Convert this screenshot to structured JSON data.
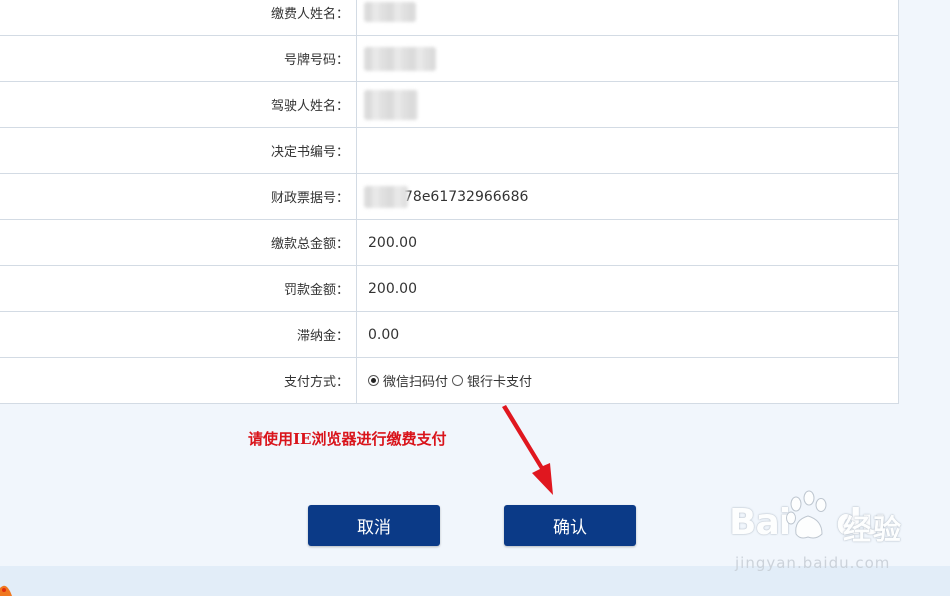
{
  "form": {
    "payer_name_label": "缴费人姓名：",
    "plate_number_label": "号牌号码：",
    "driver_name_label": "驾驶人姓名：",
    "decision_number_label": "决定书编号：",
    "decision_number_value": "",
    "receipt_number_label": "财政票据号：",
    "receipt_number_value_visible": "78e61732966686",
    "total_amount_label": "缴款总金额：",
    "total_amount_value": "200.00",
    "fine_amount_label": "罚款金额：",
    "fine_amount_value": "200.00",
    "late_fee_label": "滞纳金：",
    "late_fee_value": "0.00",
    "payment_method_label": "支付方式：",
    "payment_options": [
      "微信扫码付",
      "银行卡支付"
    ],
    "payment_selected": "微信扫码付"
  },
  "notice": "请使用IE浏览器进行缴费支付",
  "buttons": {
    "cancel": "取消",
    "confirm": "确认"
  },
  "watermark": {
    "brand": "Bai",
    "brand_suffix": "du",
    "jingyan": "经验",
    "url": "jingyan.baidu.com"
  },
  "colors": {
    "button_bg": "#0b3a87",
    "notice_red": "#d9141b",
    "arrow_red": "#e0171f",
    "page_bg": "#f1f6fc"
  }
}
